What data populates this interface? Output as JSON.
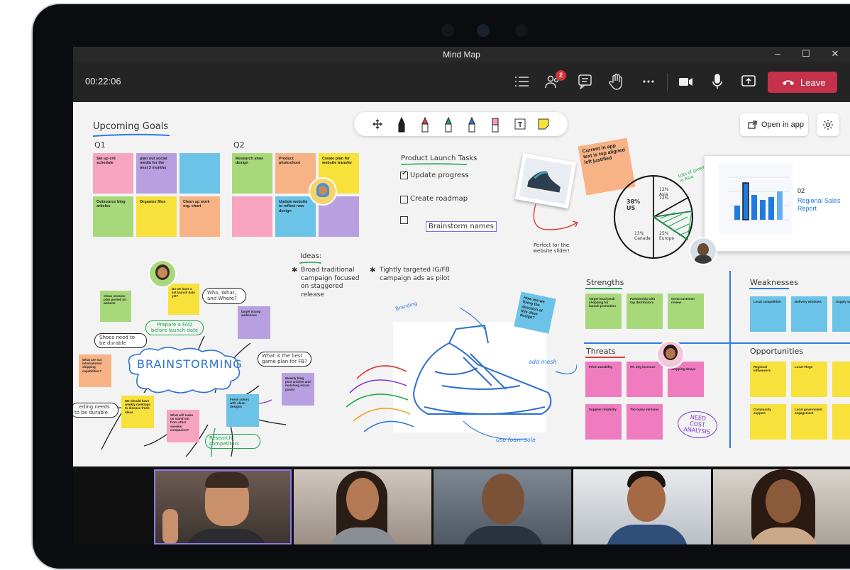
{
  "window": {
    "title": "Mind Map"
  },
  "toolbar": {
    "timer": "00:22:06",
    "participants_badge": "2",
    "leave_label": "Leave"
  },
  "board": {
    "open_in_app": "Open in app",
    "goals": {
      "title": "Upcoming Goals",
      "q1_label": "Q1",
      "q2_label": "Q2",
      "q1_notes": [
        "Set up crit schedule",
        "plan out social media for the next 3 months",
        "",
        "Outsource blog articles",
        "Organize files",
        "Clean up work org. chart"
      ],
      "q2_notes": [
        "Research shoe design",
        "Product photoshoot",
        "Create plan for website transfer",
        "",
        "Update website to reflect new design",
        ""
      ]
    },
    "tasks": {
      "title": "Product Launch Tasks",
      "items": [
        "Update progress",
        "Create roadmap",
        "Brainstorm names"
      ]
    },
    "ideas": {
      "title": "Ideas:",
      "items": [
        "Broad traditional campaign focused on staggered release",
        "Tightly targeted IG/FB campaign ads as pilot"
      ]
    },
    "shoe_note": "Perfect for the website slider!",
    "shoe_sketch_labels": {
      "top": "Branding",
      "right": "add mesh",
      "bottom": "use foam sole"
    },
    "sticky_current_app": "Current in app text is top aligned left justified",
    "sticky_blue_shoe": "How are we fixing the direction of this shoe design?",
    "pie": {
      "labels": [
        "38% US",
        "13% Canada",
        "25% Europe",
        "12% Asia",
        "12%"
      ],
      "annotation": "Lots of growth in Asia"
    },
    "report": {
      "number": "02",
      "title": "Regional Sales Report"
    },
    "brainstorm": {
      "center": "BRAINSTORMING",
      "labels": [
        "Prepare a FAQ before launch date",
        "Shoes need to be durable",
        "Who, What, and Where?",
        "What is the best game plan for FB?",
        "Research competitors",
        "...eding needs to be durable"
      ],
      "notes": [
        "Clean mission plan posted on website",
        "Do we have a set launch date yet?",
        "target young audiences",
        "What are our international shipping capabilities?",
        "Weekly blog post articles and matching social posts!",
        "We should have weekly meetings to discuss fresh ideas",
        "What will make us stand out from other sneaker companies?",
        "Fresh colors with clean designs"
      ]
    },
    "swot": {
      "strengths": {
        "title": "Strengths",
        "notes": [
          "Target local peak shopping for launch promotion",
          "Partnership with top distributors",
          "Great customer review"
        ]
      },
      "weaknesses": {
        "title": "Weaknesses",
        "notes": [
          "Local competition",
          "Delivery windows",
          "Supply uncertain"
        ]
      },
      "threats": {
        "title": "Threats",
        "notes": [
          "Price variability",
          "9% mfg increase",
          "Shipping delays",
          "Supplier reliability",
          "Too many versions"
        ],
        "annotation": "NEED COST ANALYSIS"
      },
      "opportunities": {
        "title": "Opportunities",
        "notes": [
          "Regional influencers",
          "Local Vlogs",
          "",
          "Community support",
          "Local government engagement",
          ""
        ]
      }
    }
  },
  "colors": {
    "leave": "#c4314b",
    "toolbar": "#242424",
    "board": "#f3f3f3"
  }
}
